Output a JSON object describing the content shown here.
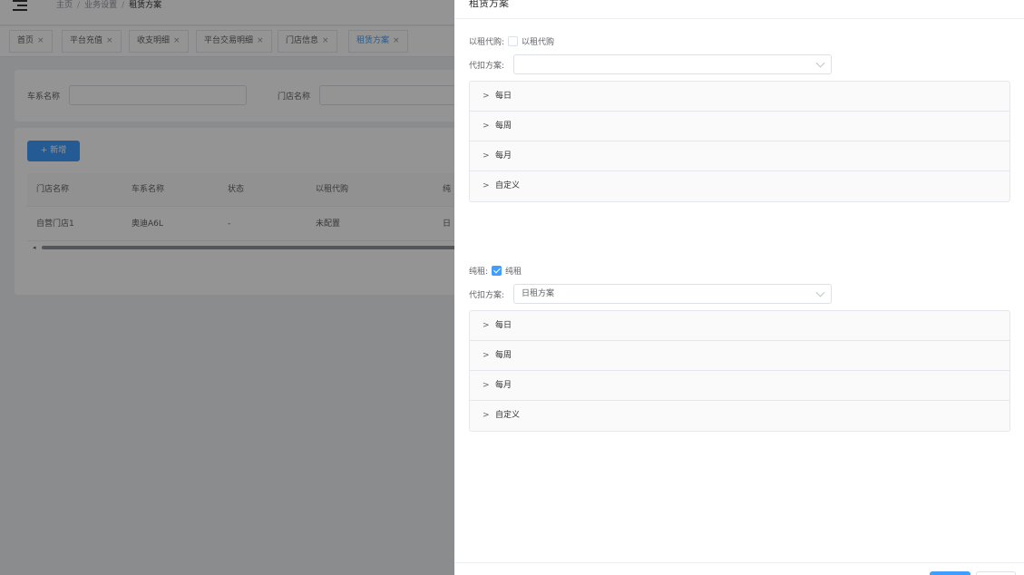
{
  "breadcrumb": {
    "home": "主页",
    "section": "业务设置",
    "current": "租赁方案"
  },
  "tabs": [
    {
      "label": "首页"
    },
    {
      "label": "平台充值"
    },
    {
      "label": "收支明细"
    },
    {
      "label": "平台交易明细"
    },
    {
      "label": "门店信息"
    },
    {
      "label": "租赁方案"
    }
  ],
  "tab_close": "×",
  "filters": {
    "series_label": "车系名称",
    "store_label": "门店名称"
  },
  "add_button": "+ 新增",
  "table": {
    "headers": [
      "门店名称",
      "车系名称",
      "状态",
      "以租代购",
      "纯"
    ],
    "rows": [
      {
        "store": "自营门店1",
        "series": "奥迪A6L",
        "status": "-",
        "lease_to_own": "未配置",
        "pure": "日"
      }
    ]
  },
  "drawer": {
    "title": "租赁方案",
    "section1": {
      "label": "以租代购:",
      "checkbox_label": "以租代购",
      "checked": false,
      "plan_label": "代扣方案:",
      "plan_value": "",
      "items": [
        "每日",
        "每周",
        "每月",
        "自定义"
      ]
    },
    "section2": {
      "label": "纯租:",
      "checkbox_label": "纯租",
      "checked": true,
      "plan_label": "代扣方案:",
      "plan_value": "日租方案",
      "items": [
        "每日",
        "每周",
        "每月",
        "自定义"
      ]
    },
    "collapse_arrow": ">"
  },
  "colors": {
    "primary": "#409eff",
    "mask": "rgba(0,0,0,0.42)"
  }
}
